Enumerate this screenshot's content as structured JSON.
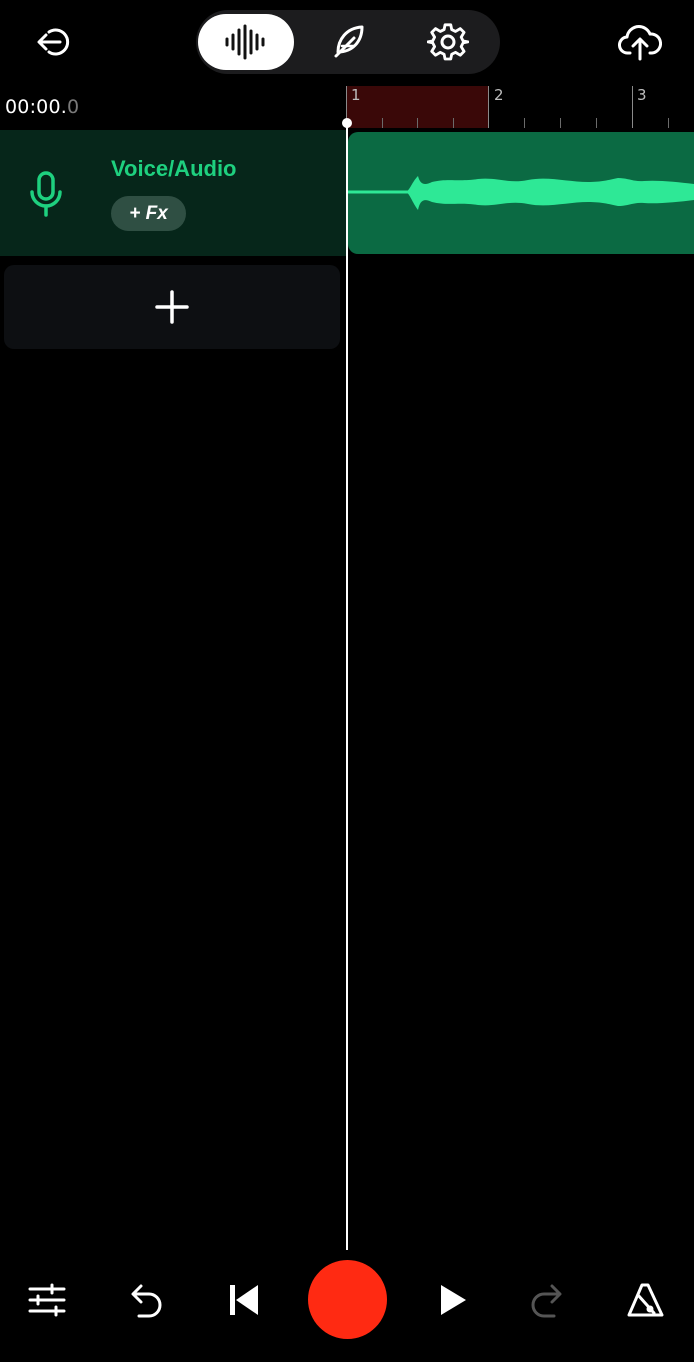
{
  "header": {
    "exit_icon": "exit-arrow-icon",
    "mode_tabs": [
      {
        "name": "waveform",
        "icon": "waveform-icon",
        "active": true
      },
      {
        "name": "lyrics",
        "icon": "feather-icon",
        "active": false
      },
      {
        "name": "settings",
        "icon": "gear-icon",
        "active": false
      }
    ],
    "upload_icon": "cloud-upload-icon"
  },
  "timeline": {
    "time_main": "00:00.",
    "time_fraction": "0",
    "ruler_labels": [
      "1",
      "2",
      "3"
    ]
  },
  "track": {
    "name": "Voice/Audio",
    "fx_label": "+ Fx",
    "icon": "microphone-icon",
    "color": "#1ed07f",
    "clip_color": "#0b6a43"
  },
  "add_track_icon": "plus-icon",
  "controls": {
    "mixer_icon": "sliders-icon",
    "undo_icon": "undo-icon",
    "rewind_icon": "skip-to-start-icon",
    "record_color": "#ff2a12",
    "play_icon": "play-icon",
    "redo_icon": "redo-icon",
    "metronome_icon": "metronome-icon"
  }
}
